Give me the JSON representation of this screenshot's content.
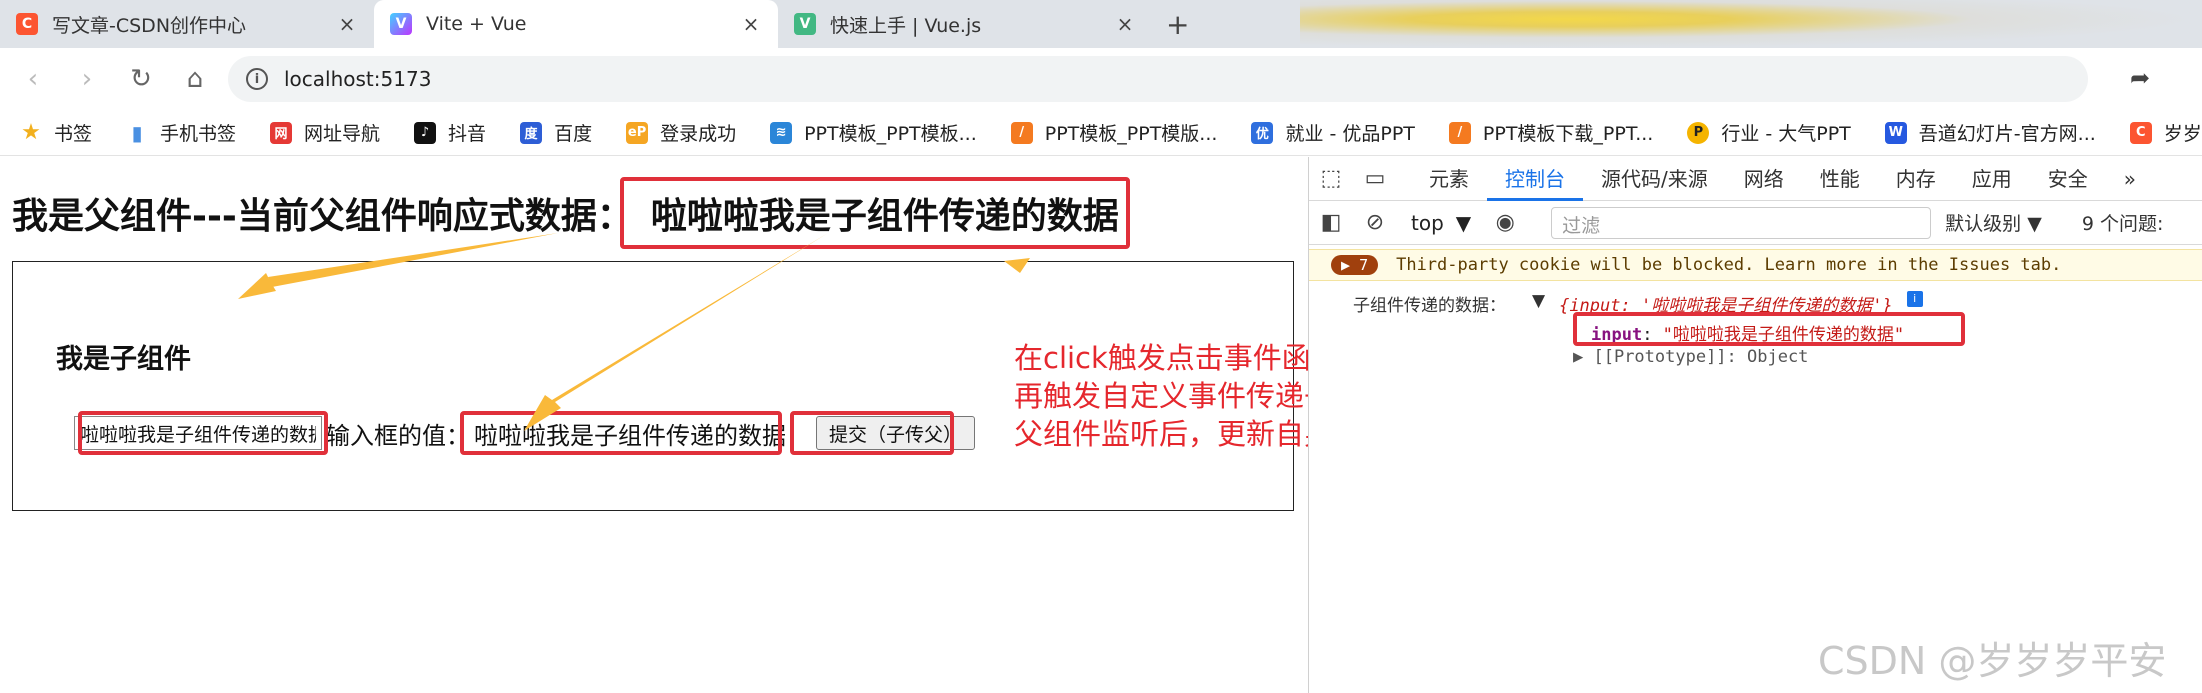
{
  "browser": {
    "tabs": [
      {
        "label": "写文章-CSDN创作中心",
        "close": "×",
        "favicon": "C",
        "color": "#fc5531"
      },
      {
        "label": "Vite + Vue",
        "close": "×",
        "favicon": "V",
        "color": "#9b6bff"
      },
      {
        "label": "快速上手 | Vue.js",
        "close": "×",
        "favicon": "V",
        "color": "#42b883"
      }
    ],
    "new_tab": "+",
    "nav": {
      "back": "‹",
      "forward": "›",
      "reload": "↻",
      "home": "⌂"
    },
    "url": "localhost:5173",
    "bookmarks": [
      {
        "label": "书签",
        "icon": "★",
        "color": "#f2b01e"
      },
      {
        "label": "手机书签",
        "icon": "▮",
        "color": "#4a90e2"
      },
      {
        "label": "网址导航",
        "icon": "网",
        "color": "#e53935"
      },
      {
        "label": "抖音",
        "icon": "♪",
        "color": "#111111"
      },
      {
        "label": "百度",
        "icon": "度",
        "color": "#2e5ed6"
      },
      {
        "label": "登录成功",
        "icon": "eP",
        "color": "#f5a623"
      },
      {
        "label": "PPT模板_PPT模板...",
        "icon": "≋",
        "color": "#2b86d8"
      },
      {
        "label": "PPT模板_PPT模版...",
        "icon": "/",
        "color": "#f47a20"
      },
      {
        "label": "就业 - 优品PPT",
        "icon": "优",
        "color": "#2f6fde"
      },
      {
        "label": "PPT模板下载_PPT...",
        "icon": "/",
        "color": "#f47a20"
      },
      {
        "label": "行业 - 大气PPT",
        "icon": "P",
        "color": "#f5b400"
      },
      {
        "label": "吾道幻灯片-官方网...",
        "icon": "W",
        "color": "#2659e0"
      },
      {
        "label": "岁岁岁平安 -CSD",
        "icon": "C",
        "color": "#fc5531"
      }
    ]
  },
  "page": {
    "parent_title": "我是父组件---当前父组件响应式数据：",
    "parent_value": "啦啦啦我是子组件传递的数据",
    "child_title": "我是子组件",
    "input_value": "啦啦啦我是子组件传递的数据",
    "input_label": "输入框的值：",
    "bound_value": "啦啦啦我是子组件传递的数据",
    "submit_label": "提交（子传父）",
    "annotation": [
      "在click触发点击事件函数",
      "再触发自定义事件传递子组件参数值",
      "父组件监听后，更新自身响应式变量！"
    ],
    "arrow_color": "#f9b93a",
    "highlight_color": "#e0303a"
  },
  "devtools": {
    "tabs": [
      "元素",
      "控制台",
      "源代码/来源",
      "网络",
      "性能",
      "内存",
      "应用",
      "安全"
    ],
    "active_tab": "控制台",
    "more": "»",
    "context": "top",
    "filter_placeholder": "过滤",
    "levels": "默认级别 ▼",
    "issues": "9 个问题:",
    "warning": {
      "count": "7",
      "text": "Third-party cookie will be blocked. Learn more in the Issues tab."
    },
    "log_label": "子组件传递的数据：",
    "log_object": "{input: '啦啦啦我是子组件传递的数据'}",
    "prop_key": "input",
    "prop_value": "\"啦啦啦我是子组件传递的数据\"",
    "prototype": "[[Prototype]]: Object"
  },
  "watermark": "CSDN @岁岁岁平安"
}
